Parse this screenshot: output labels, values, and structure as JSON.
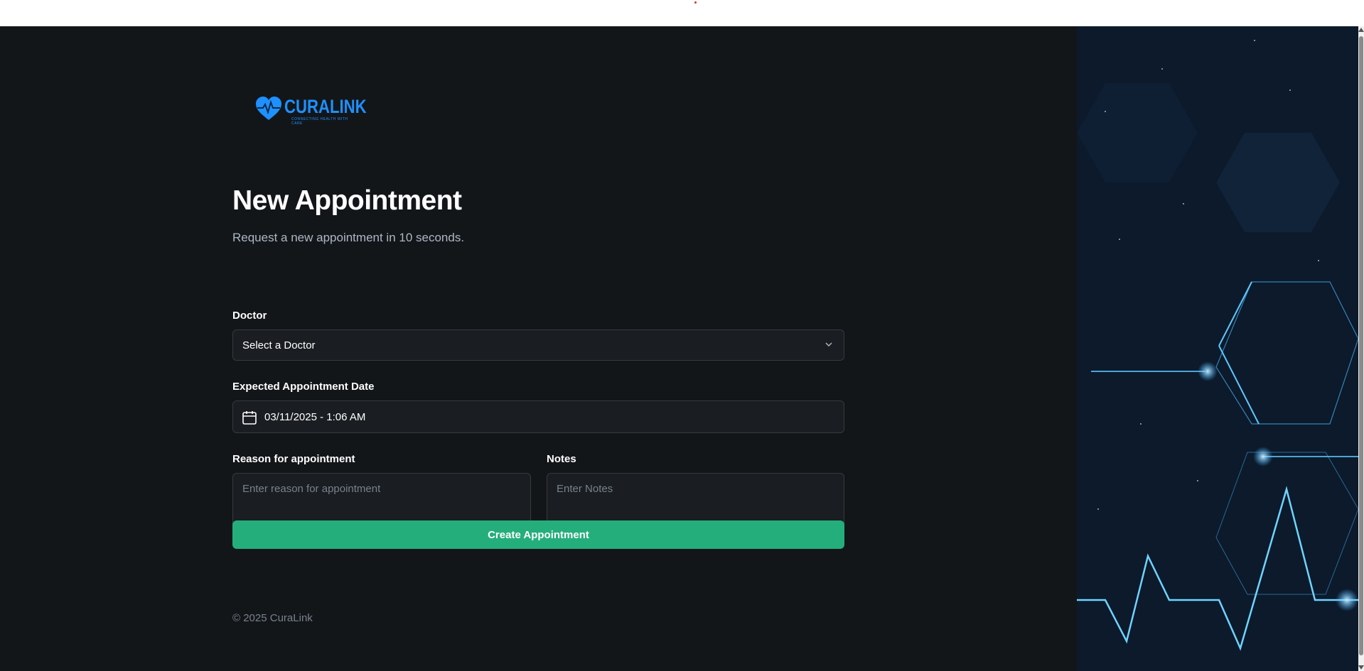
{
  "brand": {
    "logo_text": "CURALINK",
    "tagline": "CONNECTING HEALTH WITH CARE",
    "colors": {
      "accent": "#1e90ff",
      "button": "#24ae7c",
      "background": "#131619",
      "input": "#1a1d21"
    }
  },
  "page": {
    "title": "New Appointment",
    "subtitle": "Request a new appointment in 10 seconds."
  },
  "form": {
    "doctor": {
      "label": "Doctor",
      "value": "Select a Doctor",
      "icon": "chevron-down-icon"
    },
    "date": {
      "label": "Expected Appointment Date",
      "value": "03/11/2025 - 1:06 AM",
      "icon": "calendar-icon"
    },
    "reason": {
      "label": "Reason for appointment",
      "placeholder": "Enter reason for appointment"
    },
    "notes": {
      "label": "Notes",
      "placeholder": "Enter Notes"
    },
    "submit_label": "Create Appointment"
  },
  "footer": {
    "copyright": "© 2025 CuraLink"
  }
}
